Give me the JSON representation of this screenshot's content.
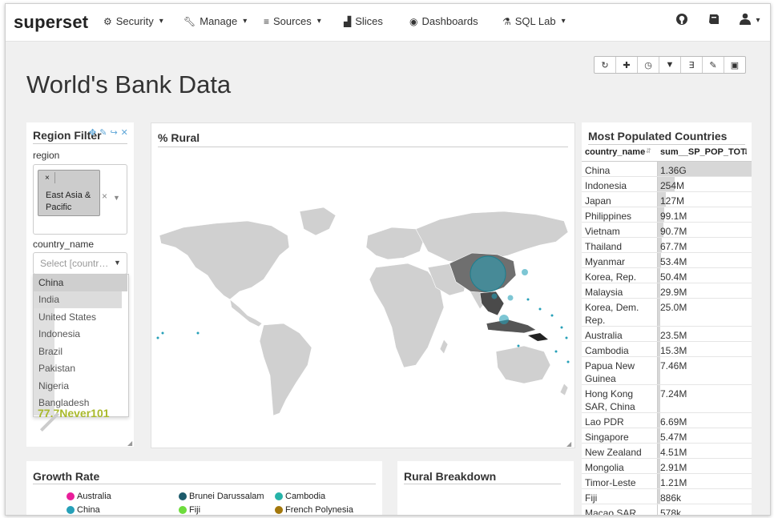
{
  "navbar": {
    "brand": "superset",
    "items": [
      {
        "label": "Security",
        "icon": "gears-icon",
        "dropdown": true
      },
      {
        "label": "Manage",
        "icon": "wrench-icon",
        "dropdown": true
      },
      {
        "label": "Sources",
        "icon": "database-icon",
        "dropdown": true
      },
      {
        "label": "Slices",
        "icon": "bar-chart-icon",
        "dropdown": false
      },
      {
        "label": "Dashboards",
        "icon": "dashboard-icon",
        "dropdown": false
      },
      {
        "label": "SQL Lab",
        "icon": "flask-icon",
        "dropdown": true
      }
    ],
    "right_icons": [
      "github-icon",
      "book-icon",
      "user-icon"
    ]
  },
  "dashboard": {
    "title": "World's Bank Data",
    "toolbar_icons": [
      "refresh-icon",
      "plus-icon",
      "clock-icon",
      "filter-icon",
      "css-icon",
      "edit-icon",
      "save-icon"
    ]
  },
  "region_filter": {
    "title": "Region Filter",
    "region_label": "region",
    "region_tag": "East Asia & Pacific",
    "tag_remove": "×",
    "clear": "×",
    "country_label": "country_name",
    "country_placeholder": "Select [country_name]",
    "options": [
      "China",
      "India",
      "United States",
      "Indonesia",
      "Brazil",
      "Pakistan",
      "Nigeria",
      "Bangladesh"
    ],
    "below_text": "77.7Never101"
  },
  "map_panel": {
    "title": "% Rural"
  },
  "table_panel": {
    "title": "Most Populated Countries",
    "columns": [
      "country_name",
      "sum__SP_POP_TOTL"
    ],
    "rows": [
      {
        "country": "China",
        "value": "1.36G",
        "share": 1.0
      },
      {
        "country": "Indonesia",
        "value": "254M",
        "share": 0.187
      },
      {
        "country": "Japan",
        "value": "127M",
        "share": 0.093
      },
      {
        "country": "Philippines",
        "value": "99.1M",
        "share": 0.073
      },
      {
        "country": "Vietnam",
        "value": "90.7M",
        "share": 0.067
      },
      {
        "country": "Thailand",
        "value": "67.7M",
        "share": 0.05
      },
      {
        "country": "Myanmar",
        "value": "53.4M",
        "share": 0.039
      },
      {
        "country": "Korea, Rep.",
        "value": "50.4M",
        "share": 0.037
      },
      {
        "country": "Malaysia",
        "value": "29.9M",
        "share": 0.022
      },
      {
        "country": "Korea, Dem. Rep.",
        "value": "25.0M",
        "share": 0.018
      },
      {
        "country": "Australia",
        "value": "23.5M",
        "share": 0.017
      },
      {
        "country": "Cambodia",
        "value": "15.3M",
        "share": 0.011
      },
      {
        "country": "Papua New Guinea",
        "value": "7.46M",
        "share": 0.005
      },
      {
        "country": "Hong Kong SAR, China",
        "value": "7.24M",
        "share": 0.005
      },
      {
        "country": "Lao PDR",
        "value": "6.69M",
        "share": 0.005
      },
      {
        "country": "Singapore",
        "value": "5.47M",
        "share": 0.004
      },
      {
        "country": "New Zealand",
        "value": "4.51M",
        "share": 0.003
      },
      {
        "country": "Mongolia",
        "value": "2.91M",
        "share": 0.002
      },
      {
        "country": "Timor-Leste",
        "value": "1.21M",
        "share": 0.001
      },
      {
        "country": "Fiji",
        "value": "886k",
        "share": 0.001
      },
      {
        "country": "Macao SAR,",
        "value": "578k",
        "share": 0.0
      }
    ]
  },
  "growth_panel": {
    "title": "Growth Rate",
    "legend": [
      {
        "name": "Australia",
        "color": "#e91e9a"
      },
      {
        "name": "Brunei Darussalam",
        "color": "#1c5a6b"
      },
      {
        "name": "Cambodia",
        "color": "#26b3a8"
      },
      {
        "name": "China",
        "color": "#26a0b8"
      },
      {
        "name": "Fiji",
        "color": "#6ddc3c"
      },
      {
        "name": "French Polynesia",
        "color": "#a3780c"
      }
    ]
  },
  "rural_panel": {
    "title": "Rural Breakdown"
  }
}
